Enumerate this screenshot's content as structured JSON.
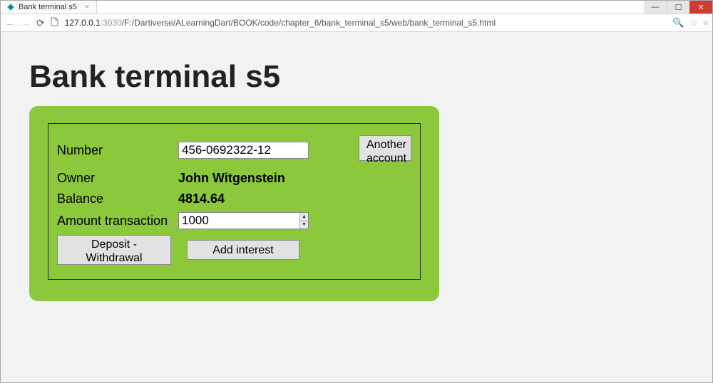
{
  "window": {
    "tab_title": "Bank terminal s5",
    "url_host": "127.0.0.1",
    "url_port": ":3030",
    "url_path": "/F:/Dartiverse/ALearningDart/BOOK/code/chapter_6/bank_terminal_s5/web/bank_terminal_s5.html"
  },
  "page": {
    "heading": "Bank terminal s5"
  },
  "form": {
    "labels": {
      "number": "Number",
      "owner": "Owner",
      "balance": "Balance",
      "amount": "Amount transaction"
    },
    "values": {
      "number": "456-0692322-12",
      "owner": "John Witgenstein",
      "balance": "4814.64",
      "amount": "1000"
    },
    "buttons": {
      "another_account": "Another account",
      "deposit_withdrawal": "Deposit - Withdrawal",
      "add_interest": "Add interest"
    }
  }
}
